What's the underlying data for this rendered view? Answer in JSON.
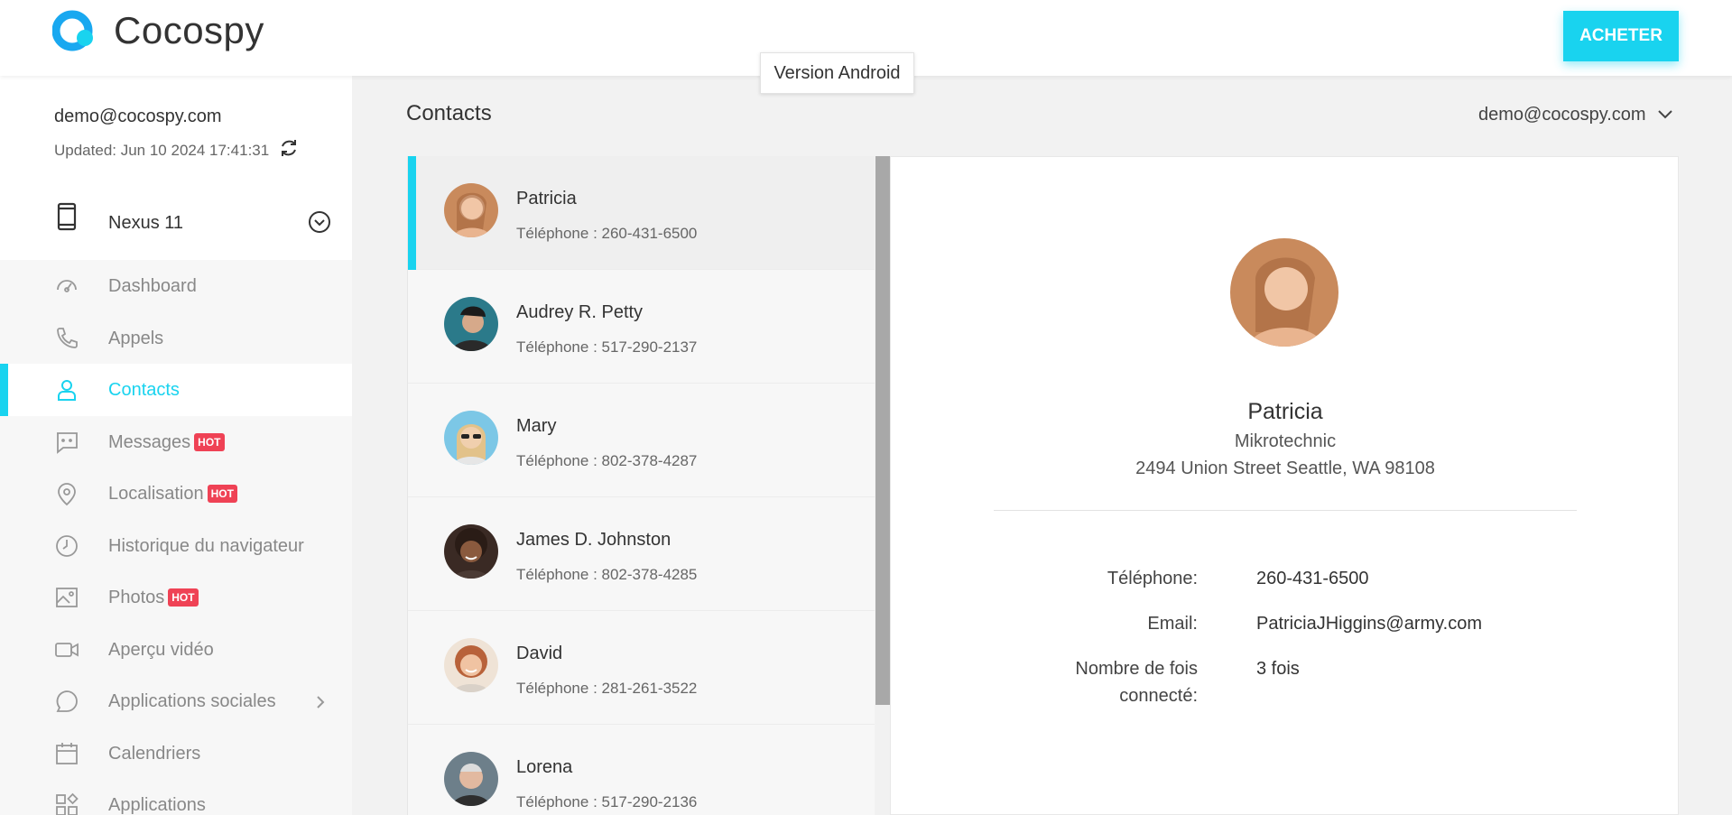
{
  "app": {
    "name": "Cocospy"
  },
  "header": {
    "buy_label": "ACHETER",
    "tooltip": "Version Android"
  },
  "account": {
    "email": "demo@cocospy.com",
    "updated": "Updated: Jun 10 2024 17:41:31",
    "device": "Nexus 11"
  },
  "nav": [
    {
      "label": "Dashboard",
      "icon": "dashboard-icon",
      "hot": ""
    },
    {
      "label": "Appels",
      "icon": "phone-icon",
      "hot": ""
    },
    {
      "label": "Contacts",
      "icon": "user-icon",
      "hot": "",
      "active": true
    },
    {
      "label": "Messages",
      "icon": "message-icon",
      "hot": "HOT"
    },
    {
      "label": "Localisation",
      "icon": "location-pin-icon",
      "hot": "HOT"
    },
    {
      "label": "Historique du navigateur",
      "icon": "clock-icon",
      "hot": ""
    },
    {
      "label": "Photos",
      "icon": "image-icon",
      "hot": "HOT"
    },
    {
      "label": "Aperçu vidéo",
      "icon": "video-icon",
      "hot": ""
    },
    {
      "label": "Applications sociales",
      "icon": "chat-bubble-icon",
      "hot": ""
    },
    {
      "label": "Calendriers",
      "icon": "calendar-icon",
      "hot": ""
    },
    {
      "label": "Applications",
      "icon": "apps-grid-icon",
      "hot": ""
    }
  ],
  "main": {
    "title": "Contacts",
    "account_select": "demo@cocospy.com"
  },
  "contacts": [
    {
      "name": "Patricia",
      "phone": "Téléphone : 260-431-6500"
    },
    {
      "name": "Audrey R. Petty",
      "phone": "Téléphone : 517-290-2137"
    },
    {
      "name": "Mary",
      "phone": "Téléphone : 802-378-4287"
    },
    {
      "name": "James D. Johnston",
      "phone": "Téléphone : 802-378-4285"
    },
    {
      "name": "David",
      "phone": "Téléphone : 281-261-3522"
    },
    {
      "name": "Lorena",
      "phone": "Téléphone : 517-290-2136"
    }
  ],
  "detail": {
    "name": "Patricia",
    "company": "Mikrotechnic",
    "address": "2494 Union Street Seattle, WA 98108",
    "phone_label": "Téléphone:",
    "phone": "260-431-6500",
    "email_label": "Email:",
    "email": "PatriciaJHiggins@army.com",
    "count_label_1": "Nombre de fois",
    "count_label_2": "connecté:",
    "count": "3 fois"
  },
  "colors": {
    "accent": "#19d3ef",
    "hot": "#ef4255"
  }
}
